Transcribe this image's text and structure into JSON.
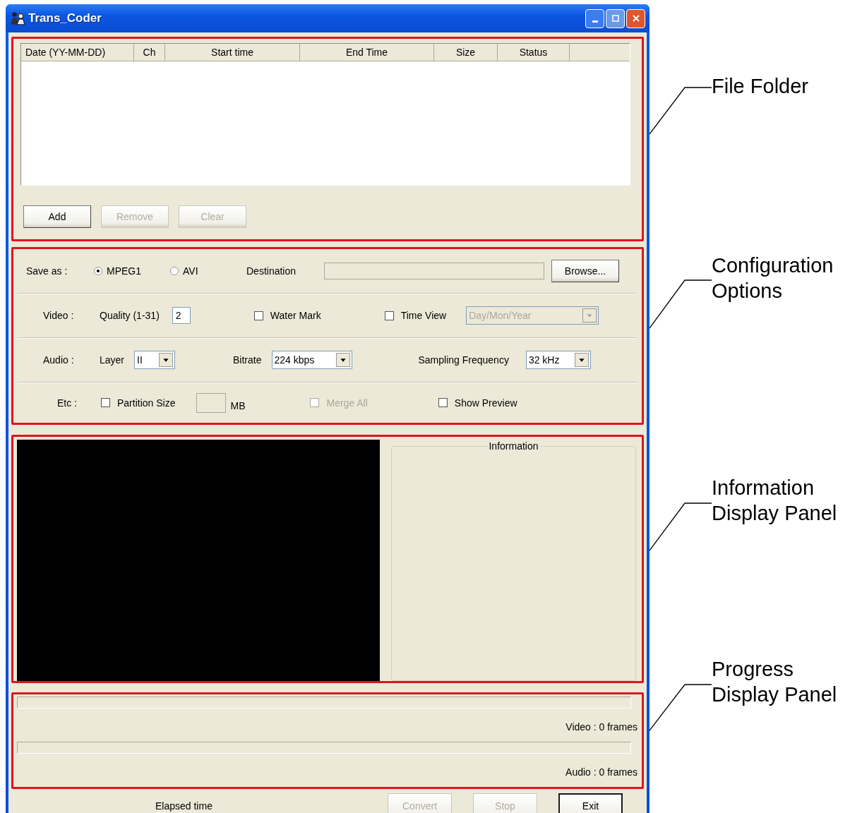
{
  "window": {
    "title": "Trans_Coder"
  },
  "file_folder": {
    "columns": [
      "Date (YY-MM-DD)",
      "Ch",
      "Start time",
      "End Time",
      "Size",
      "Status"
    ],
    "buttons": [
      {
        "label": "Add",
        "disabled": false
      },
      {
        "label": "Remove",
        "disabled": true
      },
      {
        "label": "Clear",
        "disabled": true
      }
    ]
  },
  "configuration": {
    "save_as": {
      "label": "Save as :",
      "options": [
        {
          "label": "MPEG1",
          "selected": true
        },
        {
          "label": "AVI",
          "selected": false
        }
      ],
      "destination_label": "Destination",
      "browse_button": "Browse..."
    },
    "video": {
      "label": "Video :",
      "quality_label": "Quality (1-31)",
      "quality_value": "2",
      "water_mark": {
        "label": "Water Mark",
        "checked": false
      },
      "time_view": {
        "label": "Time View",
        "checked": false
      },
      "time_format": {
        "value": "Day/Mon/Year",
        "disabled": true
      }
    },
    "audio": {
      "label": "Audio :",
      "layer_label": "Layer",
      "layer_value": "II",
      "bitrate_label": "Bitrate",
      "bitrate_value": "224 kbps",
      "sampling_label": "Sampling Frequency",
      "sampling_value": "32 kHz"
    },
    "etc": {
      "label": "Etc :",
      "partition_size": {
        "label": "Partition Size",
        "checked": false,
        "disabled": false
      },
      "size_unit": "MB",
      "merge_all": {
        "label": "Merge All",
        "checked": false,
        "disabled": true
      },
      "show_preview": {
        "label": "Show Preview",
        "checked": false,
        "disabled": false
      }
    }
  },
  "information_panel": {
    "title": "Information"
  },
  "progress": [
    {
      "level": 0,
      "reading": "Video : 0 frames"
    },
    {
      "level": 0,
      "reading": "Audio : 0 frames"
    }
  ],
  "footer": {
    "elapsed_label": "Elapsed time",
    "buttons": [
      {
        "label": "Convert",
        "disabled": true,
        "default": false
      },
      {
        "label": "Stop",
        "disabled": true,
        "default": false
      },
      {
        "label": "Exit",
        "disabled": false,
        "default": true
      }
    ]
  },
  "annotations": [
    "File Folder",
    "Configuration\nOptions",
    "Information\nDisplay Panel",
    "Progress\nDisplay Panel"
  ]
}
